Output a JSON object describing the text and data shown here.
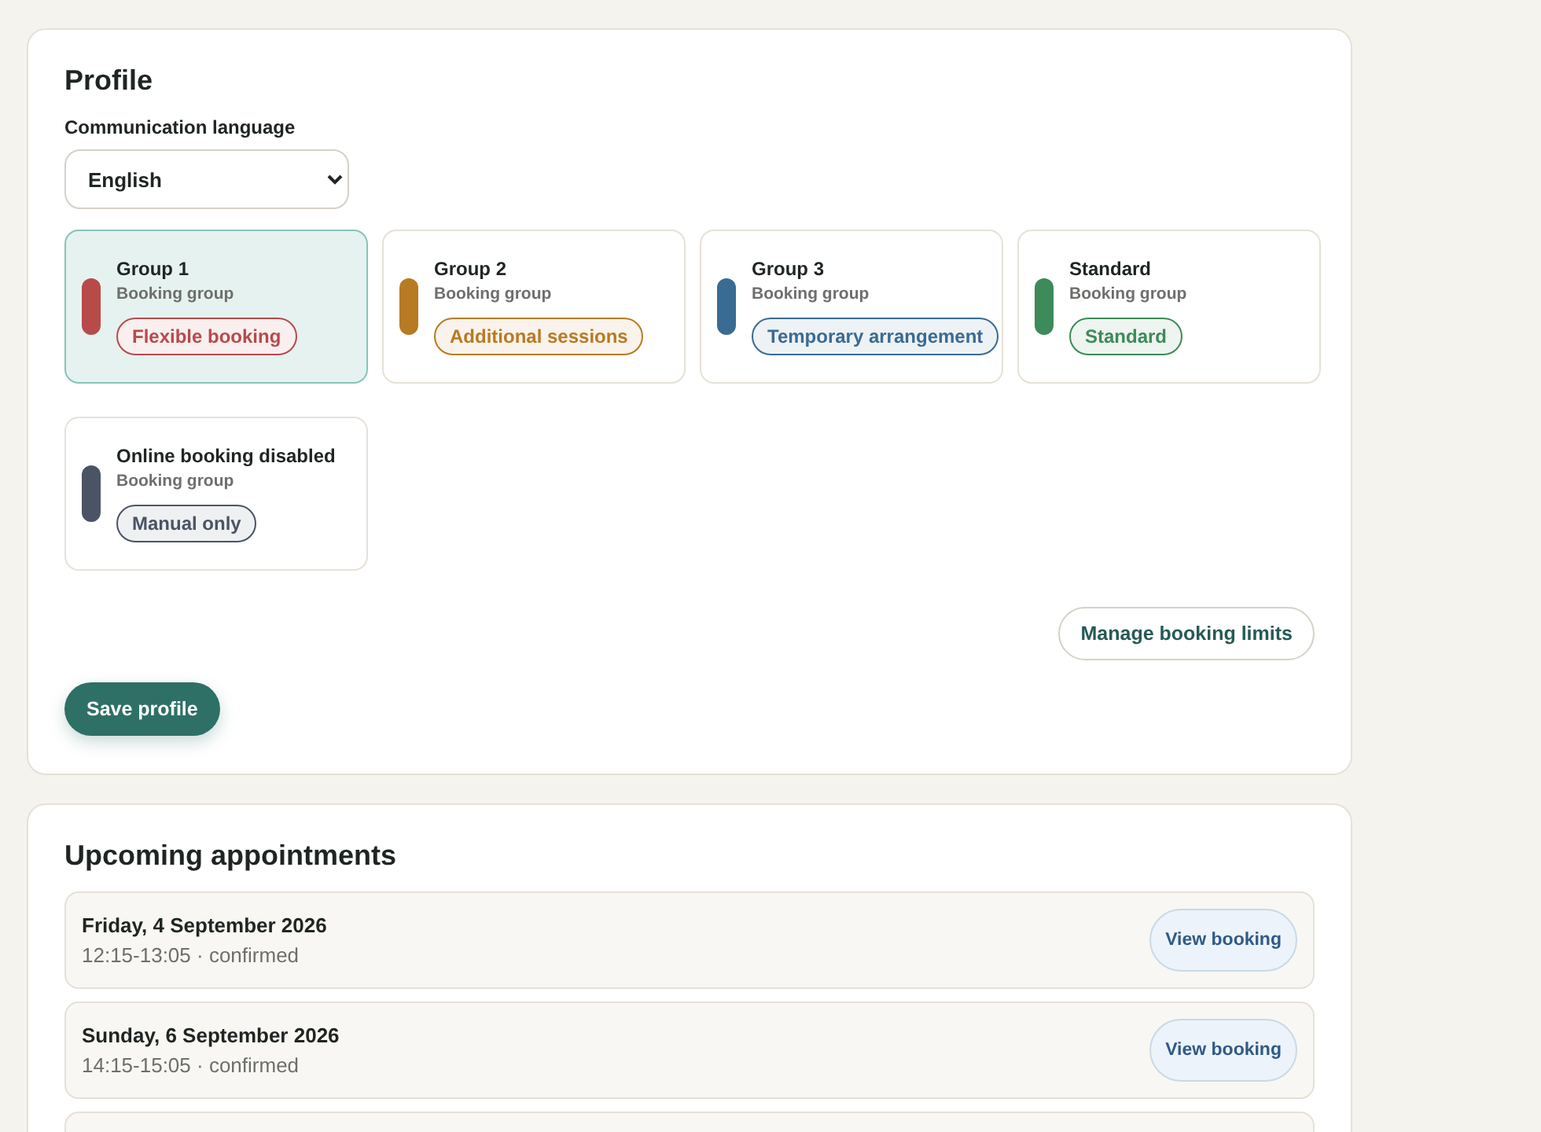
{
  "profile": {
    "title": "Profile",
    "language_label": "Communication language",
    "language_value": "English",
    "groups": [
      {
        "name": "Group 1",
        "subtitle": "Booking group",
        "tag": "Flexible booking",
        "color": "#b84a4a",
        "selected": true
      },
      {
        "name": "Group 2",
        "subtitle": "Booking group",
        "tag": "Additional sessions",
        "color": "#b87a22",
        "selected": false
      },
      {
        "name": "Group 3",
        "subtitle": "Booking group",
        "tag": "Temporary arrangement",
        "color": "#3a6b92",
        "selected": false
      },
      {
        "name": "Standard",
        "subtitle": "Booking group",
        "tag": "Standard",
        "color": "#3d8a5a",
        "selected": false
      },
      {
        "name": "Online booking disabled",
        "subtitle": "Booking group",
        "tag": "Manual only",
        "color": "#4a5465",
        "selected": false
      }
    ],
    "manage_button": "Manage booking limits",
    "save_button": "Save profile"
  },
  "appointments": {
    "title": "Upcoming appointments",
    "more_below": true,
    "items": [
      {
        "date": "Friday, 4 September 2026",
        "detail": "12:15-13:05 · confirmed",
        "button": "View booking"
      },
      {
        "date": "Sunday, 6 September 2026",
        "detail": "14:15-15:05 · confirmed",
        "button": "View booking"
      }
    ]
  }
}
